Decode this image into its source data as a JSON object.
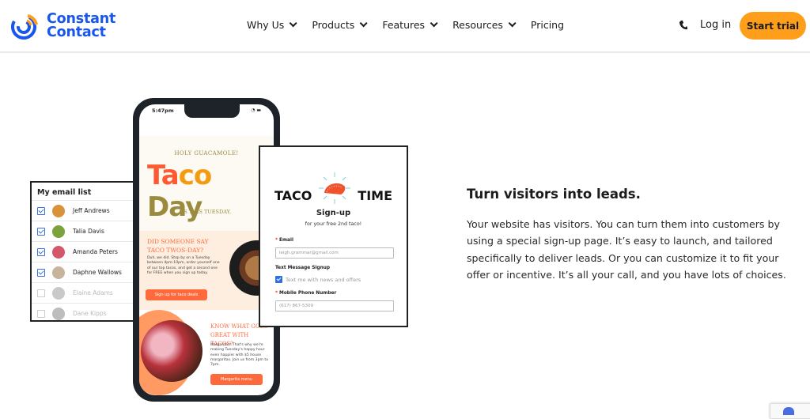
{
  "header": {
    "logo_line1": "Constant",
    "logo_line2": "Contact",
    "nav": [
      {
        "label": "Why Us",
        "has_dropdown": true
      },
      {
        "label": "Products",
        "has_dropdown": true
      },
      {
        "label": "Features",
        "has_dropdown": true
      },
      {
        "label": "Resources",
        "has_dropdown": true
      },
      {
        "label": "Pricing",
        "has_dropdown": false
      }
    ],
    "phone_icon": "phone-icon",
    "login_label": "Log in",
    "start_trial_label": "Start trial",
    "brand_color": "#1856ed",
    "accent_color": "#ff9e1b"
  },
  "email_list": {
    "title": "My email list",
    "contacts": [
      {
        "name": "Jeff Andrews",
        "checked": true,
        "avatar_color": "#d9923a"
      },
      {
        "name": "Talia Davis",
        "checked": true,
        "avatar_color": "#7aa33c"
      },
      {
        "name": "Amanda Peters",
        "checked": true,
        "avatar_color": "#d4576a"
      },
      {
        "name": "Daphne Wallows",
        "checked": true,
        "avatar_color": "#c7b49a"
      },
      {
        "name": "Elaine Adams",
        "checked": false,
        "avatar_color": "#c9c9c9"
      },
      {
        "name": "Dane Kipps",
        "checked": false,
        "avatar_color": "#bdbdbd"
      }
    ]
  },
  "phone": {
    "time": "5:47pm",
    "kicker": "HOLY GUACAMOLE!",
    "title_part1": "Ta",
    "title_part2": "co",
    "title_part3": " Day",
    "subtitle": "IS THIS TUESDAY.",
    "promo1": {
      "heading": "DID SOMEONE SAY TACO TWOS-DAY?",
      "text": "Duh, we did. Stop by on a Tuesday between 4pm-10pm, order yourself one of our top tacos, and get a second one for FREE when you sign up today.",
      "button": "Sign up for taco deals"
    },
    "promo2": {
      "heading": "KNOW WHAT GOES GREAT WITH TACOS?",
      "text": "Margaritas! That's why we're making Tuesday's happy hour even happier with $5 house margaritas. Join us from 3pm to 7pm.",
      "button": "Margarita menu"
    }
  },
  "signup_form": {
    "word1": "TACO",
    "word2": "TIME",
    "title": "Sign-up",
    "subtitle": "for your free 2nd taco!",
    "email_label": "Email",
    "email_value": "leigh.grammar@gmail.com",
    "sms_label": "Text Message Signup",
    "sms_checkbox_label": "Text me with news and offers",
    "sms_checked": true,
    "phone_label": "Mobile Phone Number",
    "phone_value": "(617) 867-5309"
  },
  "content": {
    "headline": "Turn visitors into leads.",
    "body": "Your website has visitors. You can turn them into customers by using a special sign-up page. It’s easy to launch, and tailored specifically to deliver leads. Or you can customize it to fit your offer or incentive. It’s all your call, and you have lots of choices."
  }
}
